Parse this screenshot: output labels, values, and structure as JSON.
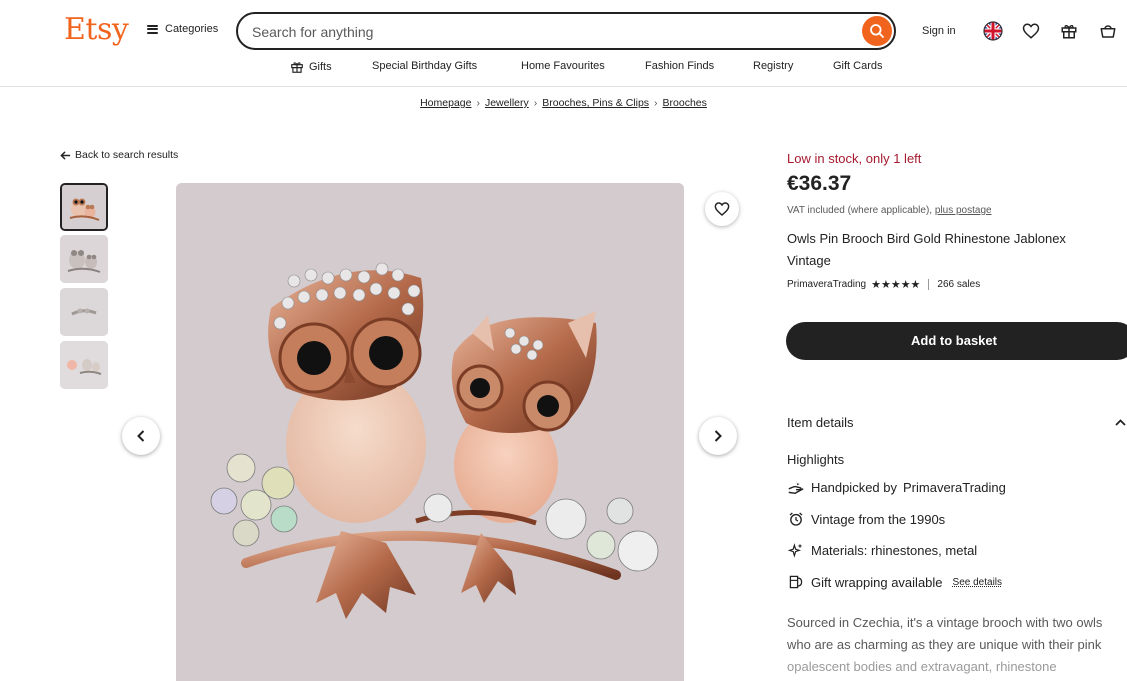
{
  "header": {
    "logo": "Etsy",
    "categories_label": "Categories",
    "search_placeholder": "Search for anything",
    "signin_label": "Sign in"
  },
  "nav": {
    "items": [
      "Gifts",
      "Special Birthday Gifts",
      "Home Favourites",
      "Fashion Finds",
      "Registry",
      "Gift Cards"
    ]
  },
  "breadcrumb": [
    "Homepage",
    "Jewellery",
    "Brooches, Pins & Clips",
    "Brooches"
  ],
  "gallery": {
    "back_label": "Back to search results",
    "thumbnail_count": 4
  },
  "product": {
    "stock_message": "Low in stock, only 1 left",
    "price": "€36.37",
    "vat_text": "VAT included (where applicable),",
    "postage_link": "plus postage",
    "title": "Owls Pin Brooch Bird Gold Rhinestone Jablonex Vintage",
    "shop_name": "PrimaveraTrading",
    "rating_stars": "★★★★★",
    "sales": "266 sales",
    "add_to_basket": "Add to basket"
  },
  "details": {
    "section_title": "Item details",
    "highlights_title": "Highlights",
    "highlights": [
      {
        "icon": "hand-icon",
        "text": "Handpicked by",
        "strong": "PrimaveraTrading"
      },
      {
        "icon": "alarm-clock-icon",
        "text": "Vintage from the 1990s"
      },
      {
        "icon": "sparkle-icon",
        "text": "Materials: rhinestones, metal"
      },
      {
        "icon": "gift-wrap-icon",
        "text": "Gift wrapping available",
        "link": "See details"
      }
    ],
    "description_lines": [
      "Sourced in Czechia, it's a vintage brooch with two owls",
      "who are as charming as they are unique with their pink",
      "opalescent bodies and extravagant, rhinestone"
    ]
  },
  "colors": {
    "brand": "#f1641e",
    "stock_red": "#a61a2e",
    "button_dark": "#222222"
  }
}
